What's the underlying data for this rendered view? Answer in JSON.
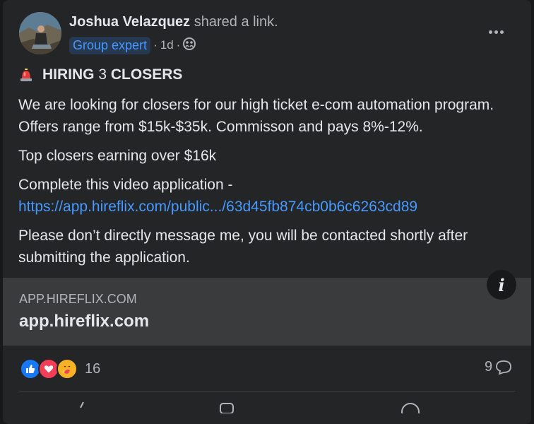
{
  "post": {
    "author": "Joshua Velazquez",
    "action": " shared a link.",
    "badge": "Group expert",
    "time": "1d",
    "separator": "·",
    "headline_pre": "HIRING ",
    "headline_num": "3",
    "headline_post": " CLOSERS",
    "paragraphs": [
      "We are looking for closers for our high ticket e-com automation program. Offers range from $15k-$35k. Commisson and pays 8%-12%.",
      "Top closers earning over $16k"
    ],
    "cta_text": "Complete this video application -",
    "cta_link": "https://app.hireflix.com/public.../63d45fb874cb0b6c6263cd89",
    "closing": "Please don’t directly message me, you will be contacted shortly after submitting the application."
  },
  "link_preview": {
    "domain": "APP.HIREFLIX.COM",
    "title": "app.hireflix.com"
  },
  "engagement": {
    "reaction_count": "16",
    "comment_count": "9",
    "reactions": [
      "like-icon",
      "love-icon",
      "care-icon"
    ]
  },
  "icons": {
    "more": "more-options-icon",
    "audience": "group-audience-icon",
    "info": "info-icon",
    "headline": "siren-emoji-icon",
    "comment": "comment-bubble-icon"
  },
  "colors": {
    "card": "#242526",
    "link": "#4599ff",
    "badge_bg": "#263951",
    "preview_bg": "#3a3b3c"
  }
}
